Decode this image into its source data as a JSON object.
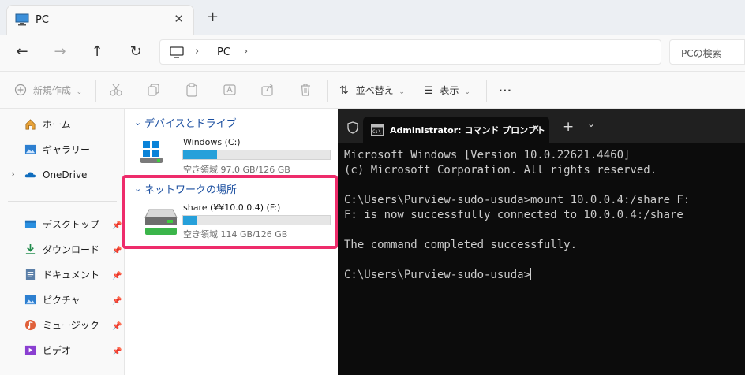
{
  "tab": {
    "title": "PC",
    "close": "✕",
    "new_tab": "+"
  },
  "nav": {
    "back": "←",
    "forward": "→",
    "up": "↑",
    "refresh": "↻"
  },
  "address": {
    "location": "PC",
    "separator": "›"
  },
  "search": {
    "placeholder": "PCの検索"
  },
  "toolbar": {
    "new_label": "新規作成",
    "sort_label": "並べ替え",
    "view_label": "表示",
    "more_label": "···"
  },
  "sidebar": {
    "items": [
      {
        "label": "ホーム",
        "icon": "home-icon"
      },
      {
        "label": "ギャラリー",
        "icon": "gallery-icon"
      },
      {
        "label": "OneDrive",
        "icon": "onedrive-icon"
      }
    ],
    "quick": [
      {
        "label": "デスクトップ",
        "icon": "desktop-folder-icon"
      },
      {
        "label": "ダウンロード",
        "icon": "download-icon"
      },
      {
        "label": "ドキュメント",
        "icon": "documents-icon"
      },
      {
        "label": "ピクチャ",
        "icon": "pictures-icon"
      },
      {
        "label": "ミュージック",
        "icon": "music-icon"
      },
      {
        "label": "ビデオ",
        "icon": "video-icon"
      }
    ]
  },
  "content": {
    "devices_group": "デバイスとドライブ",
    "network_group": "ネットワークの場所",
    "drive_c": {
      "name": "Windows (C:)",
      "free": "空き領域 97.0 GB/126 GB",
      "used_fraction": 0.23
    },
    "drive_f": {
      "name": "share (¥¥10.0.0.4) (F:)",
      "free": "空き領域 114 GB/126 GB",
      "used_fraction": 0.09
    }
  },
  "terminal": {
    "tab_title": "Administrator: コマンド プロンプト",
    "close": "✕",
    "new_tab": "+",
    "dropdown": "⌄",
    "lines": [
      "Microsoft Windows [Version 10.0.22621.4460]",
      "(c) Microsoft Corporation. All rights reserved.",
      "",
      "C:\\Users\\Purview-sudo-usuda>mount 10.0.0.4:/share F:",
      "F: is now successfully connected to 10.0.0.4:/share",
      "",
      "The command completed successfully.",
      "",
      "C:\\Users\\Purview-sudo-usuda>"
    ]
  },
  "colors": {
    "accent": "#26a0da",
    "highlight": "#ee2c6b",
    "terminal_bg": "#0c0c0c",
    "group_title": "#1b4fa0"
  }
}
